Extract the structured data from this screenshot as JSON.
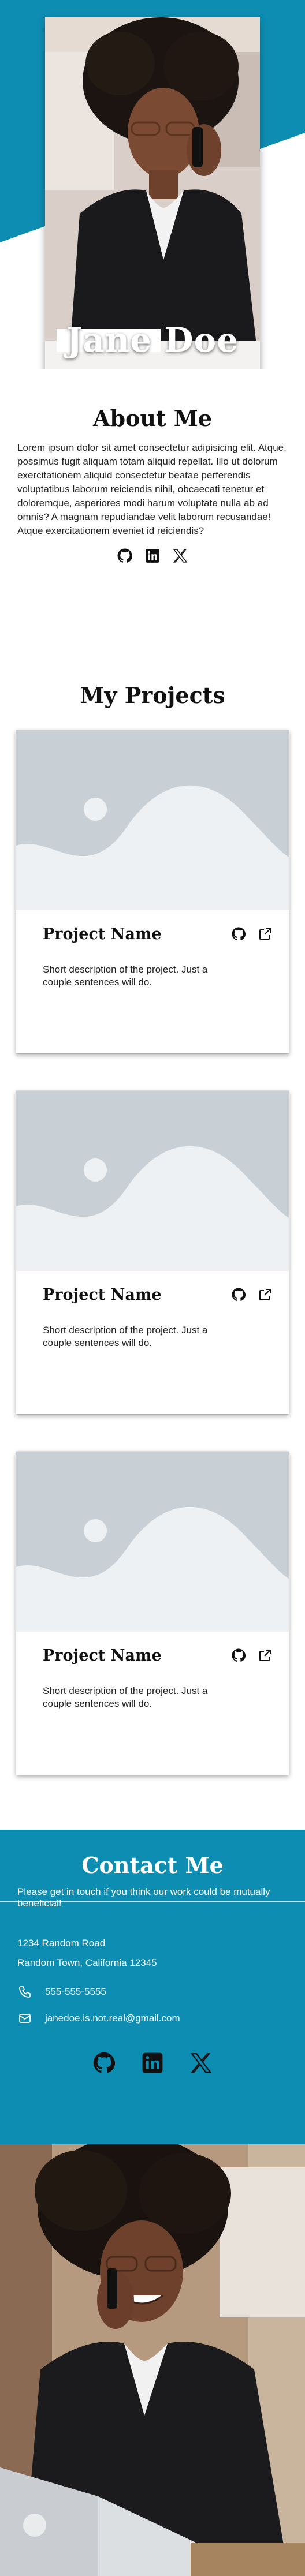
{
  "colors": {
    "accent": "#0e8db2",
    "card_image_bg": "#c8d0d6",
    "card_image_fg": "#eef1f3"
  },
  "hero": {
    "name": "Jane Doe"
  },
  "about": {
    "title": "About Me",
    "text": "Lorem ipsum dolor sit amet consectetur adipisicing elit. Atque, possimus fugit aliquam totam aliquid repellat. Illo ut dolorum exercitationem aliquid consectetur beatae perferendis voluptatibus laborum reiciendis nihil, obcaecati tenetur et doloremque, asperiores modi harum voluptate nulla ab ad omnis? A magnam repudiandae velit laborum recusandae! Atque exercitationem eveniet id reiciendis?",
    "social": [
      "github-icon",
      "linkedin-icon",
      "x-icon"
    ]
  },
  "projects": {
    "title": "My Projects",
    "items": [
      {
        "name": "Project Name",
        "description": "Short description of the project. Just a couple sentences will do."
      },
      {
        "name": "Project Name",
        "description": "Short description of the project. Just a couple sentences will do."
      },
      {
        "name": "Project Name",
        "description": "Short description of the project. Just a couple sentences will do."
      }
    ]
  },
  "contact": {
    "title": "Contact Me",
    "subtitle": "Please get in touch if you think our work could be mutually beneficial!",
    "address_line1": "1234 Random Road",
    "address_line2": "Random Town, California 12345",
    "phone": "555-555-5555",
    "email": "janedoe.is.not.real@gmail.com"
  }
}
